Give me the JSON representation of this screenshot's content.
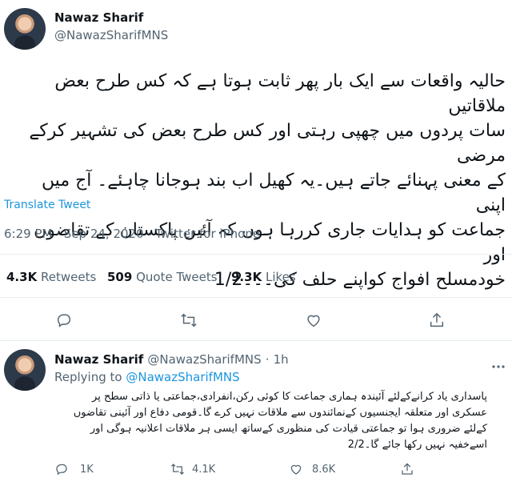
{
  "tweet": {
    "author_name": "Nawaz Sharif",
    "author_handle": "@NawazSharifMNS",
    "lines": [
      "حالیہ واقعات سے ایک بار پھر ثابت ہوتا ہے کہ کس طرح بعض ملاقاتیں",
      "سات پردوں میں چھپی رہتی اور کس طرح بعض کی تشہیر کرکے مرضی",
      "کے معنی پہنائے جاتے ہیں۔یہ کھیل اب بند ہوجانا چاہئے۔ آج میں اپنی",
      "جماعت کو ہدایات جاری کررہا ہوں کہ آئین پاکستان کے تقاضوں اور",
      "خودمسلح افواج کواپنے حلف کی۔۔۔1/2"
    ],
    "translate_label": "Translate Tweet",
    "time": "6:29 PM",
    "separator": "·",
    "date": "Sep 24, 2020",
    "source": "Twitter for iPhone",
    "retweets_count": "4.3K",
    "retweets_label": "Retweets",
    "quotes_count": "509",
    "quotes_label": "Quote Tweets",
    "likes_count": "9.3K",
    "likes_label": "Likes",
    "icons": [
      "reply-icon",
      "retweet-icon",
      "like-icon",
      "share-icon"
    ]
  },
  "reply": {
    "author_name": "Nawaz Sharif",
    "author_handle": "@NawazSharifMNS",
    "separator": "·",
    "time_ago": "1h",
    "replying_to_label": "Replying to",
    "replying_to_handle": "@NawazSharifMNS",
    "lines": [
      "پاسداری یاد کرانےکےلئے آئیندہ ہماری جماعت کا کوئی رکن،انفرادی،جماعتی یا ذاتی سطح پر",
      "عسکری اور متعلقہ ایجنسیوں کےنمائندوں سے ملاقات نہیں کرے گا۔قومی دفاع اور آئینی تقاضوں",
      "کےلئے ضروری ہوا تو جماعتی قیادت کی منظوری کےساتھ ایسی ہر ملاقات اعلانیہ ہوگی اور",
      "اسےخفیہ نہیں رکھا جائے گا۔2/2"
    ],
    "reply_count": "1K",
    "retweet_count": "4.1K",
    "like_count": "8.6K"
  },
  "colors": {
    "accent": "#1b95e0",
    "secondary_text": "#536471",
    "divider": "#e6ecf0"
  }
}
